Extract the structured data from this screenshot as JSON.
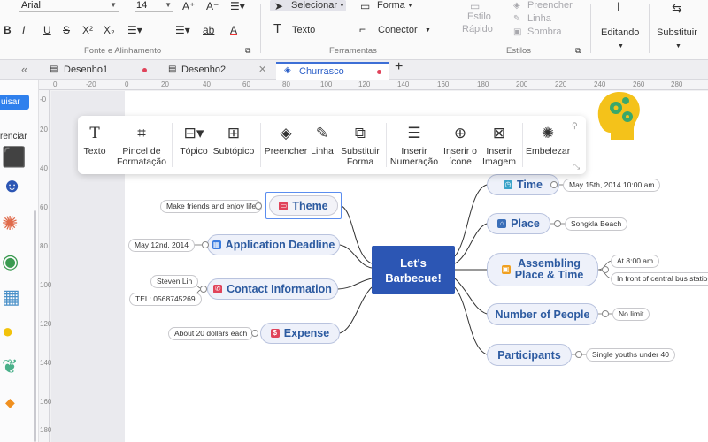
{
  "ribbon": {
    "font_name": "Arial",
    "font_size": "14",
    "font_group_label": "Fonte e Alinhamento",
    "tools_group_label": "Ferramentas",
    "styles_group_label": "Estilos",
    "select_label": "Selecionar",
    "shape_label": "Forma",
    "text_label": "Texto",
    "connector_label": "Conector",
    "quick_style_line1": "Estilo",
    "quick_style_line2": "Rápido",
    "fill_label": "Preencher",
    "line_label": "Linha",
    "shadow_label": "Sombra",
    "editing_label": "Editando",
    "replace_label": "Substituir",
    "bold": "B",
    "italic": "I",
    "underline": "U",
    "strike": "S",
    "superscript": "X²",
    "subscript": "X₂",
    "ab_label": "ab",
    "font_color": "A"
  },
  "tabs": [
    {
      "label": "Desenho1",
      "state": "unsaved"
    },
    {
      "label": "Desenho2",
      "state": "close"
    },
    {
      "label": "Churrasco",
      "state": "unsaved",
      "active": true
    }
  ],
  "new_tab": "+",
  "left_panel": {
    "search_button": "uisar",
    "section_label": "renciar",
    "collapse": "«"
  },
  "ruler": {
    "h_ticks": [
      "0",
      "-20",
      "0",
      "20",
      "40",
      "60",
      "80",
      "100",
      "120",
      "140",
      "160",
      "180",
      "200",
      "220",
      "240",
      "260",
      "280"
    ],
    "v_ticks": [
      "-0",
      "20",
      "40",
      "60",
      "80",
      "100",
      "120",
      "140",
      "160",
      "180"
    ]
  },
  "float_toolbar": {
    "items": [
      {
        "name": "texto",
        "line1": "Texto",
        "line2": "",
        "icon": "T"
      },
      {
        "name": "pincel",
        "line1": "Pincel de",
        "line2": "Formatação",
        "icon": "🖌"
      },
      {
        "name": "topico",
        "line1": "Tópico",
        "line2": "",
        "icon": "⊟"
      },
      {
        "name": "subtopico",
        "line1": "Subtópico",
        "line2": "",
        "icon": "⊞"
      },
      {
        "name": "preencher",
        "line1": "Preencher",
        "line2": "",
        "icon": "◈"
      },
      {
        "name": "linha",
        "line1": "Linha",
        "line2": "",
        "icon": "✎"
      },
      {
        "name": "substituir",
        "line1": "Substituir",
        "line2": "Forma",
        "icon": "⧉"
      },
      {
        "name": "numeracao",
        "line1": "Inserir",
        "line2": "Numeração",
        "icon": "☰"
      },
      {
        "name": "icone",
        "line1": "Inserir o",
        "line2": "ícone",
        "icon": "⊕"
      },
      {
        "name": "imagem",
        "line1": "Inserir",
        "line2": "Imagem",
        "icon": "⊠"
      },
      {
        "name": "embelezar",
        "line1": "Embelezar",
        "line2": "",
        "icon": "✺"
      }
    ]
  },
  "mindmap": {
    "central": {
      "line1": "Let's",
      "line2": "Barbecue!"
    },
    "left": [
      {
        "label": "Theme",
        "icon_color": "#e0435a",
        "leaf": "Make friends and enjoy life"
      },
      {
        "label": "Application Deadline",
        "icon_color": "#3b7de0",
        "leaf": "May 12nd, 2014"
      },
      {
        "label": "Contact Information",
        "icon_color": "#e0435a",
        "leaf1": "Steven Lin",
        "leaf2": "TEL: 0568745269"
      },
      {
        "label": "Expense",
        "icon_color": "#e0435a",
        "leaf": "About 20 dollars each"
      }
    ],
    "right": [
      {
        "label": "Time",
        "icon_color": "#3aa3c9",
        "leaf": "May 15th, 2014    10:00 am"
      },
      {
        "label": "Place",
        "icon_color": "#3b6fb8",
        "leaf": "Songkla Beach"
      },
      {
        "label_line1": "Assembling",
        "label_line2": "Place & Time",
        "icon_color": "#f0a020",
        "leaf1": "At 8:00 am",
        "leaf2": "In front of central bus station"
      },
      {
        "label": "Number of People",
        "leaf": "No limit"
      },
      {
        "label": "Participants",
        "leaf": "Single youths under 40"
      }
    ]
  }
}
